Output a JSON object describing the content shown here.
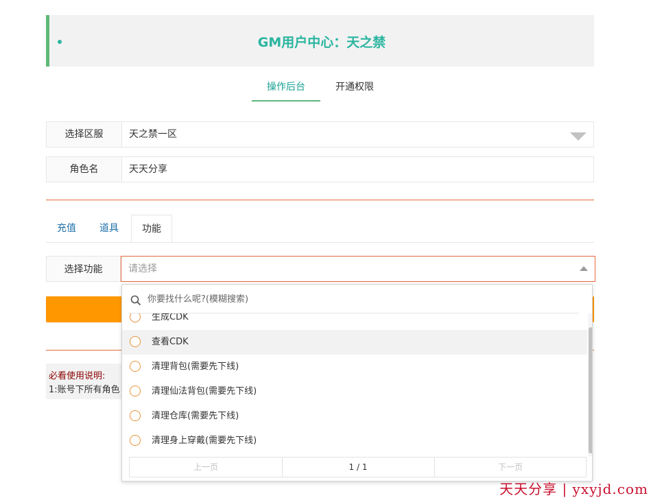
{
  "header": {
    "title": "GM用户中心：天之禁"
  },
  "top_tabs": {
    "ops": "操作后台",
    "permission": "开通权限"
  },
  "form": {
    "server_label": "选择区服",
    "server_value": "天之禁一区",
    "role_label": "角色名",
    "role_value": "天天分享"
  },
  "sub_tabs": {
    "recharge": "充值",
    "items": "道具",
    "function": "功能"
  },
  "function_select": {
    "label": "选择功能",
    "placeholder": "请选择",
    "search_placeholder": "你要找什么呢?(模糊搜索)",
    "options": [
      "生成CDK",
      "查看CDK",
      "清理背包(需要先下线)",
      "清理仙法背包(需要先下线)",
      "清理仓库(需要先下线)",
      "清理身上穿戴(需要先下线)"
    ],
    "pager": {
      "prev": "上一页",
      "page": "1 / 1",
      "next": "下一页"
    }
  },
  "notes": {
    "title": "必看使用说明:",
    "line1": "1:账号下所有角色"
  },
  "watermark": "天天分享 | yxyjd.com",
  "colors": {
    "accent": "#2bb5a0",
    "orange": "#ff9800",
    "border_active": "#e2693a"
  }
}
